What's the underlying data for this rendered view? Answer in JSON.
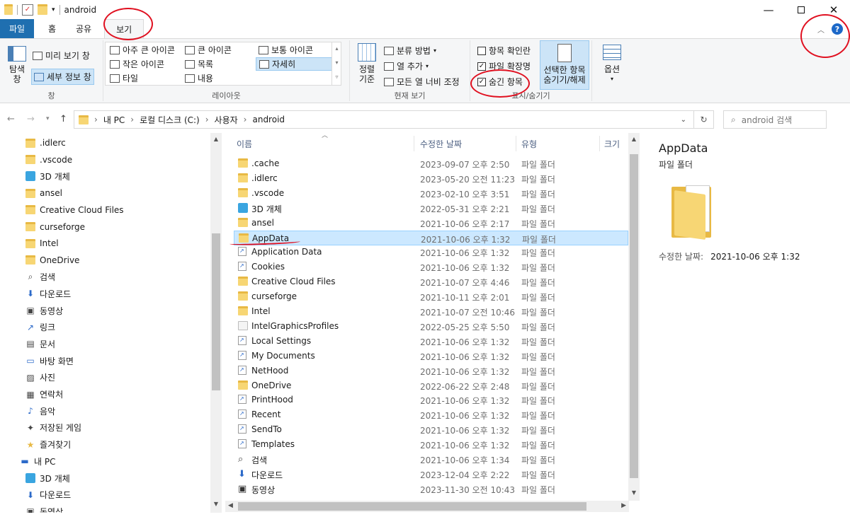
{
  "window": {
    "title": "android"
  },
  "tabs": [
    {
      "label": "파일"
    },
    {
      "label": "홈"
    },
    {
      "label": "공유"
    },
    {
      "label": "보기"
    }
  ],
  "ribbon": {
    "pane": {
      "nav_pane_label": "탐색\n창",
      "preview_pane": "미리 보기 창",
      "details_pane": "세부 정보 창",
      "group_label": "창"
    },
    "layout": {
      "items": [
        "아주 큰 아이콘",
        "큰 아이콘",
        "보통 아이콘",
        "작은 아이콘",
        "목록",
        "자세히",
        "타일",
        "내용"
      ],
      "selected": "자세히",
      "group_label": "레이아웃"
    },
    "current_view": {
      "sort_by": "정렬\n기준",
      "group_by": "분류 방법",
      "add_columns": "열 추가",
      "size_all_columns": "모든 열 너비 조정",
      "group_label": "현재 보기"
    },
    "show_hide": {
      "item_checkboxes": "항목 확인란",
      "item_checkboxes_checked": false,
      "file_extensions": "파일 확장명",
      "file_extensions_checked": true,
      "hidden_items": "숨긴 항목",
      "hidden_items_checked": true,
      "hide_selected": "선택한 항목\n숨기기/해제",
      "group_label": "표시/숨기기"
    },
    "options": {
      "label": "옵션"
    }
  },
  "address": {
    "crumbs": [
      "내 PC",
      "로컬 디스크 (C:)",
      "사용자",
      "android"
    ],
    "search_placeholder": "android 검색"
  },
  "nav_pane": [
    {
      "label": ".idlerc",
      "icon": "folder-icon"
    },
    {
      "label": ".vscode",
      "icon": "folder-icon"
    },
    {
      "label": "3D 개체",
      "icon": "cube-icon"
    },
    {
      "label": "ansel",
      "icon": "folder-icon"
    },
    {
      "label": "Creative Cloud Files",
      "icon": "folder-icon"
    },
    {
      "label": "curseforge",
      "icon": "folder-icon"
    },
    {
      "label": "Intel",
      "icon": "folder-icon"
    },
    {
      "label": "OneDrive",
      "icon": "folder-icon"
    },
    {
      "label": "검색",
      "icon": "search-icon"
    },
    {
      "label": "다운로드",
      "icon": "download-icon"
    },
    {
      "label": "동영상",
      "icon": "video-icon"
    },
    {
      "label": "링크",
      "icon": "link-icon"
    },
    {
      "label": "문서",
      "icon": "document-icon"
    },
    {
      "label": "바탕 화면",
      "icon": "desktop-icon"
    },
    {
      "label": "사진",
      "icon": "pictures-icon"
    },
    {
      "label": "연락처",
      "icon": "contacts-icon"
    },
    {
      "label": "음악",
      "icon": "music-icon"
    },
    {
      "label": "저장된 게임",
      "icon": "games-icon"
    },
    {
      "label": "즐겨찾기",
      "icon": "star-icon"
    },
    {
      "label": "내 PC",
      "icon": "pc-icon"
    },
    {
      "label": "3D 개체",
      "icon": "cube-icon"
    },
    {
      "label": "다운로드",
      "icon": "download-icon"
    },
    {
      "label": "동영상",
      "icon": "video-icon"
    }
  ],
  "columns": [
    {
      "label": "이름"
    },
    {
      "label": "수정한 날짜"
    },
    {
      "label": "유형"
    },
    {
      "label": "크기"
    }
  ],
  "files": [
    {
      "name": ".cache",
      "date": "2023-09-07 오후 2:50",
      "type": "파일 폴더",
      "icon": "folder"
    },
    {
      "name": ".idlerc",
      "date": "2023-05-20 오전 11:23",
      "type": "파일 폴더",
      "icon": "folder"
    },
    {
      "name": ".vscode",
      "date": "2023-02-10 오후 3:51",
      "type": "파일 폴더",
      "icon": "folder"
    },
    {
      "name": "3D 개체",
      "date": "2022-05-31 오후 2:21",
      "type": "파일 폴더",
      "icon": "cube"
    },
    {
      "name": "ansel",
      "date": "2021-10-06 오후 2:17",
      "type": "파일 폴더",
      "icon": "folder"
    },
    {
      "name": "AppData",
      "date": "2021-10-06 오후 1:32",
      "type": "파일 폴더",
      "icon": "folder",
      "selected": true
    },
    {
      "name": "Application Data",
      "date": "2021-10-06 오후 1:32",
      "type": "파일 폴더",
      "icon": "short"
    },
    {
      "name": "Cookies",
      "date": "2021-10-06 오후 1:32",
      "type": "파일 폴더",
      "icon": "short"
    },
    {
      "name": "Creative Cloud Files",
      "date": "2021-10-07 오후 4:46",
      "type": "파일 폴더",
      "icon": "folder"
    },
    {
      "name": "curseforge",
      "date": "2021-10-11 오후 2:01",
      "type": "파일 폴더",
      "icon": "folder"
    },
    {
      "name": "Intel",
      "date": "2021-10-07 오전 10:46",
      "type": "파일 폴더",
      "icon": "folder"
    },
    {
      "name": "IntelGraphicsProfiles",
      "date": "2022-05-25 오후 5:50",
      "type": "파일 폴더",
      "icon": "sys"
    },
    {
      "name": "Local Settings",
      "date": "2021-10-06 오후 1:32",
      "type": "파일 폴더",
      "icon": "short"
    },
    {
      "name": "My Documents",
      "date": "2021-10-06 오후 1:32",
      "type": "파일 폴더",
      "icon": "short"
    },
    {
      "name": "NetHood",
      "date": "2021-10-06 오후 1:32",
      "type": "파일 폴더",
      "icon": "short"
    },
    {
      "name": "OneDrive",
      "date": "2022-06-22 오후 2:48",
      "type": "파일 폴더",
      "icon": "folder"
    },
    {
      "name": "PrintHood",
      "date": "2021-10-06 오후 1:32",
      "type": "파일 폴더",
      "icon": "short"
    },
    {
      "name": "Recent",
      "date": "2021-10-06 오후 1:32",
      "type": "파일 폴더",
      "icon": "short"
    },
    {
      "name": "SendTo",
      "date": "2021-10-06 오후 1:32",
      "type": "파일 폴더",
      "icon": "short"
    },
    {
      "name": "Templates",
      "date": "2021-10-06 오후 1:32",
      "type": "파일 폴더",
      "icon": "short"
    },
    {
      "name": "검색",
      "date": "2021-10-06 오후 1:34",
      "type": "파일 폴더",
      "icon": "search"
    },
    {
      "name": "다운로드",
      "date": "2023-12-04 오후 2:22",
      "type": "파일 폴더",
      "icon": "download"
    },
    {
      "name": "동영상",
      "date": "2023-11-30 오전 10:43",
      "type": "파일 폴더",
      "icon": "video"
    }
  ],
  "details": {
    "title": "AppData",
    "type": "파일 폴더",
    "modified_label": "수정한 날짜:",
    "modified_value": "2021-10-06 오후 1:32"
  },
  "colors": {
    "file_tab": "#1f6fb0",
    "selection": "#cce8ff",
    "annotation": "#e01020"
  }
}
